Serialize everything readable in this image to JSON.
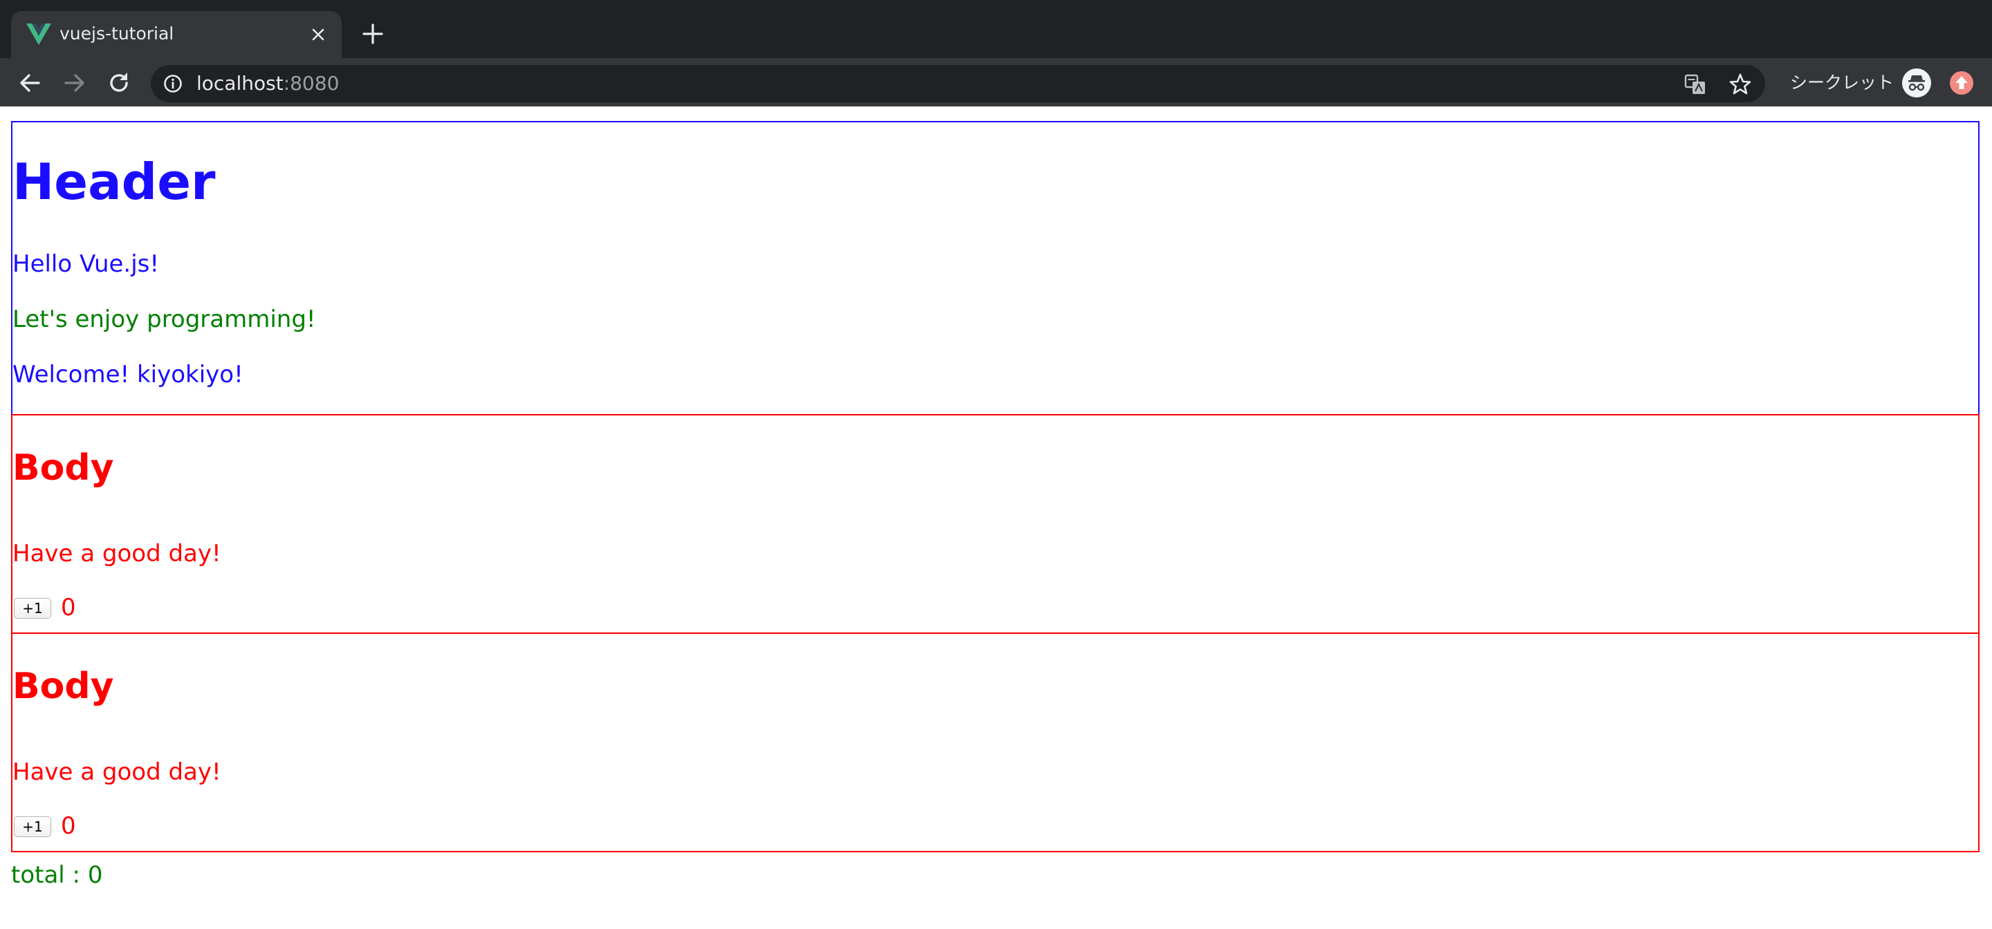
{
  "browser": {
    "tab_title": "vuejs-tutorial",
    "url_host": "localhost",
    "url_port": ":8080",
    "incognito_label": "シークレット",
    "icons": [
      "vue-favicon-icon",
      "close-icon",
      "plus-icon",
      "back-icon",
      "forward-icon",
      "reload-icon",
      "info-icon",
      "translate-icon",
      "star-icon",
      "incognito-icon",
      "update-icon"
    ]
  },
  "header": {
    "title": "Header",
    "greeting": "Hello Vue.js!",
    "message": "Let's enjoy programming!",
    "welcome": "Welcome! kiyokiyo!"
  },
  "bodies": [
    {
      "title": "Body",
      "message": "Have a good day!",
      "button_label": "+1",
      "count": "0"
    },
    {
      "title": "Body",
      "message": "Have a good day!",
      "button_label": "+1",
      "count": "0"
    }
  ],
  "total": "total : 0",
  "colors": {
    "header_blue": "#1a0dff",
    "body_red": "#ff0000",
    "green_text": "#008000",
    "chrome_dark": "#202124",
    "chrome_toolbar": "#35363a"
  }
}
